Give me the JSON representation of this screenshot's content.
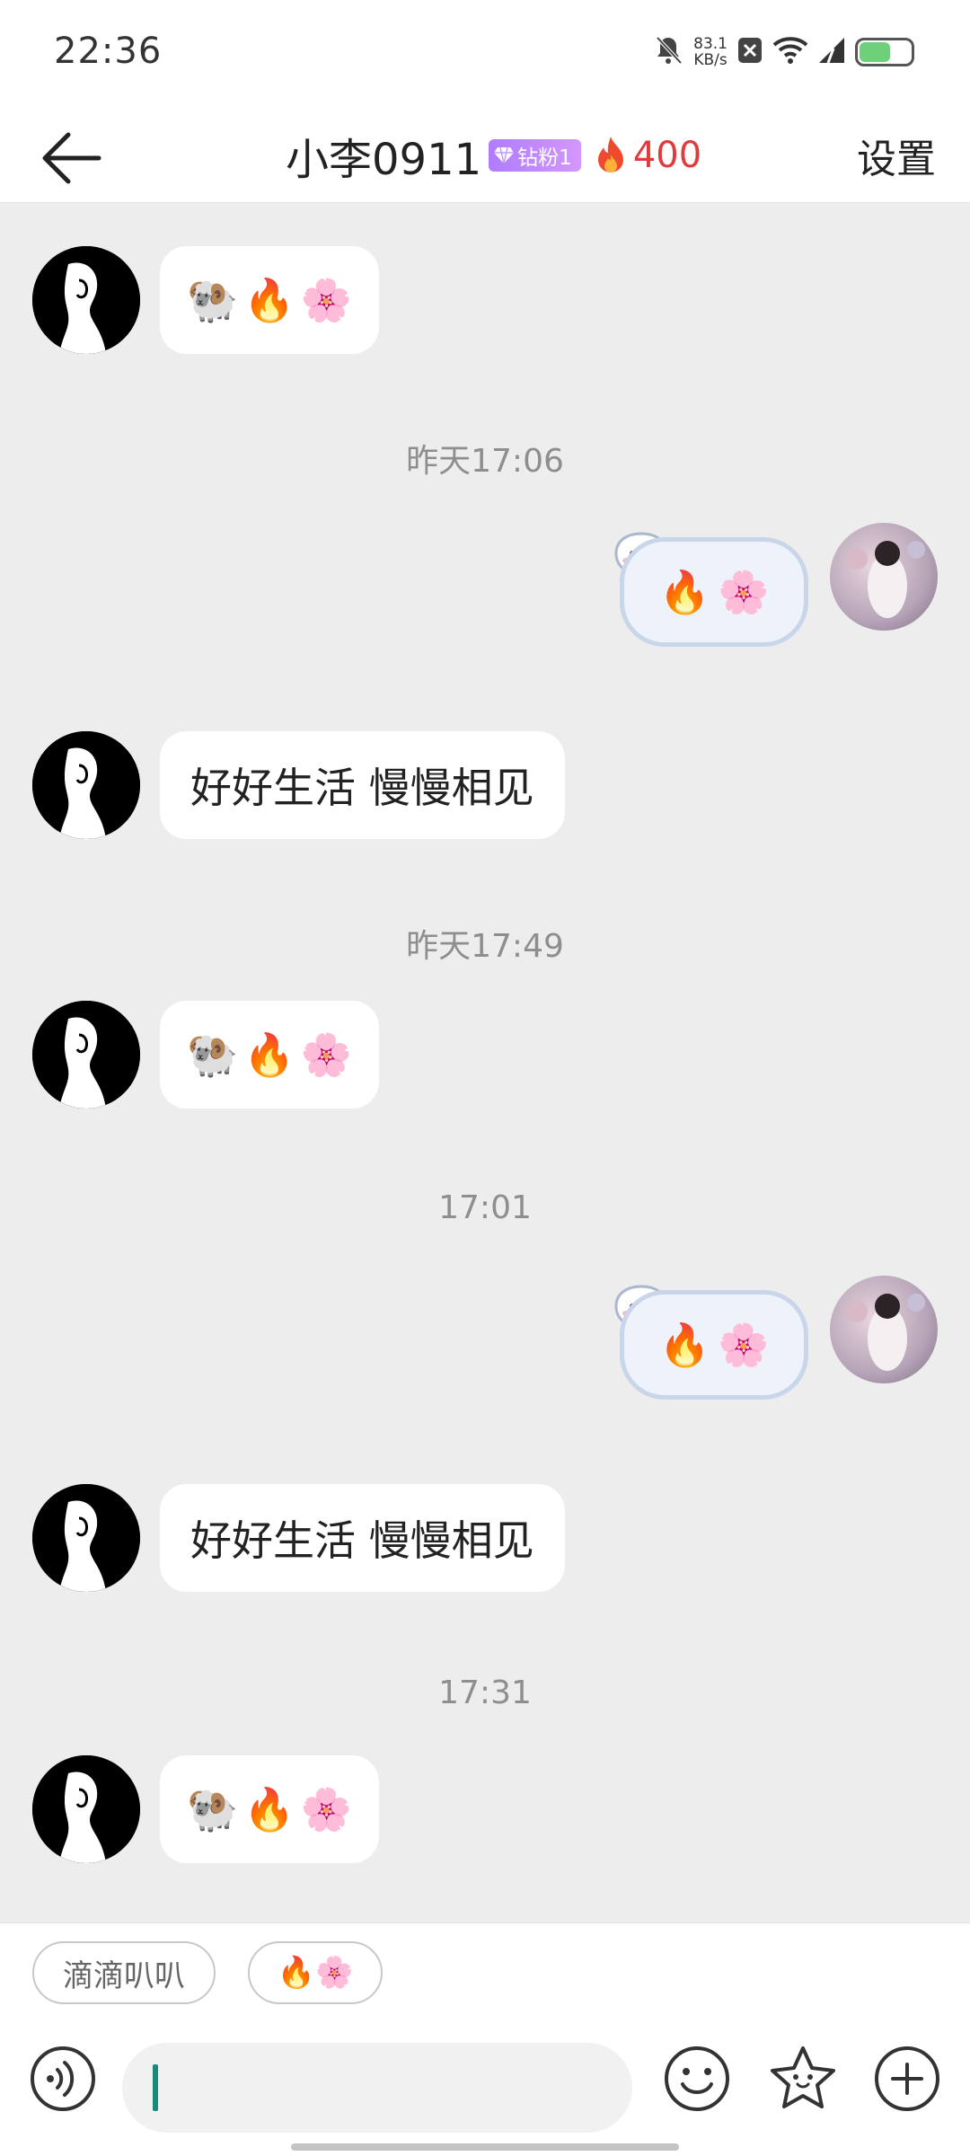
{
  "status_bar": {
    "time": "22:36",
    "net_speed_value": "83.1",
    "net_speed_unit": "KB/s",
    "icons": [
      "mute-bell-icon",
      "close-box-icon",
      "wifi-icon",
      "signal-icon",
      "battery-icon"
    ],
    "battery_level": 0.6
  },
  "header": {
    "title": "小李0911",
    "badge_label": "钻粉1",
    "fire_score": "400",
    "settings_label": "设置"
  },
  "messages": [
    {
      "side": "left",
      "type": "emoji",
      "emojis": [
        "🐏",
        "🔥",
        "🌸"
      ]
    },
    {
      "type": "timestamp",
      "text": "昨天17:06"
    },
    {
      "side": "right",
      "type": "emoji",
      "emojis": [
        "🔥",
        "🌸"
      ]
    },
    {
      "side": "left",
      "type": "text",
      "text": "好好生活 慢慢相见"
    },
    {
      "type": "timestamp",
      "text": "昨天17:49"
    },
    {
      "side": "left",
      "type": "emoji",
      "emojis": [
        "🐏",
        "🔥",
        "🌸"
      ]
    },
    {
      "type": "timestamp",
      "text": "17:01"
    },
    {
      "side": "right",
      "type": "emoji",
      "emojis": [
        "🔥",
        "🌸"
      ]
    },
    {
      "side": "left",
      "type": "text",
      "text": "好好生活 慢慢相见"
    },
    {
      "type": "timestamp",
      "text": "17:31"
    },
    {
      "side": "left",
      "type": "emoji",
      "emojis": [
        "🐏",
        "🔥",
        "🌸"
      ]
    }
  ],
  "quick_replies": [
    {
      "label": "滴滴叭叭"
    },
    {
      "label": "🔥🌸"
    }
  ],
  "input_bar": {
    "placeholder": "",
    "icons": [
      "voice-icon",
      "emoji-face-icon",
      "star-sticker-icon",
      "plus-icon"
    ]
  },
  "colors": {
    "accent_fire": "#e23a3a",
    "badge_purple": "#b07cff",
    "chat_background": "#ededed",
    "caret": "#1a8b7a"
  }
}
